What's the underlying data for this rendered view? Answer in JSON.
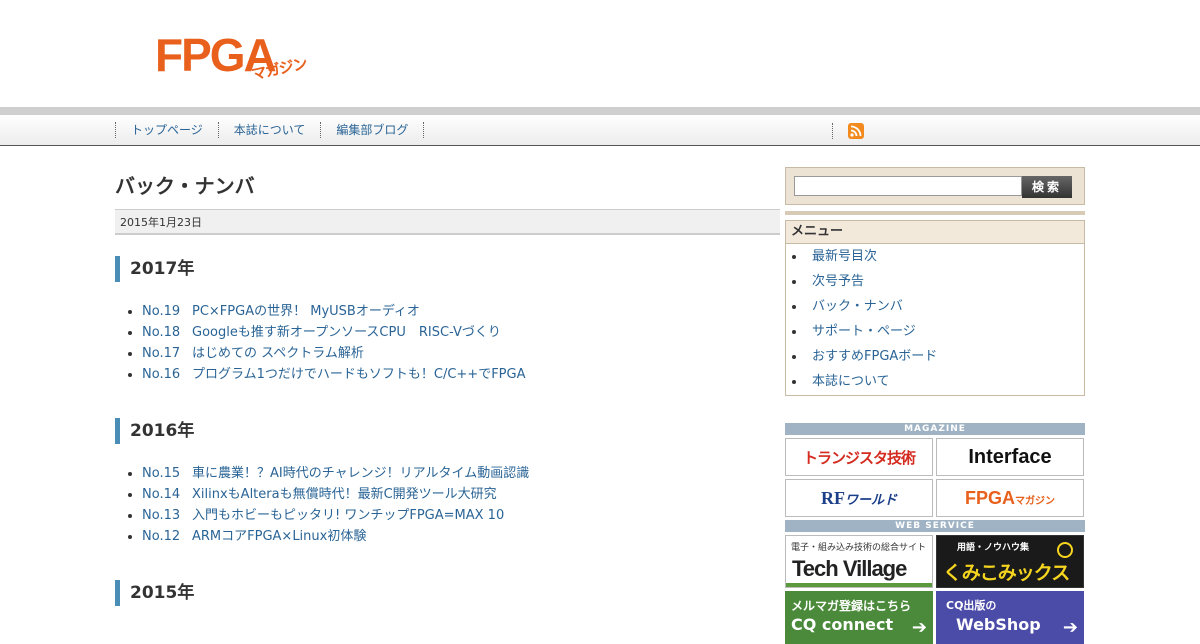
{
  "header": {
    "logo_main": "FPGA",
    "logo_sub": "マガジン"
  },
  "nav": {
    "items": [
      "トップページ",
      "本誌について",
      "編集部ブログ"
    ],
    "rss_icon": "rss-icon"
  },
  "main": {
    "title": "バック・ナンバ",
    "date": "2015年1月23日",
    "sections": [
      {
        "year": "2017年",
        "issues": [
          {
            "num": "No.19",
            "title": "PC×FPGAの世界！ MyUSBオーディオ"
          },
          {
            "num": "No.18",
            "title": "Googleも推す新オープンソースCPU　RISC-Vづくり"
          },
          {
            "num": "No.17",
            "title": "はじめての スペクトラム解析"
          },
          {
            "num": "No.16",
            "title": "プログラム1つだけでハードもソフトも！C/C++でFPGA"
          }
        ]
      },
      {
        "year": "2016年",
        "issues": [
          {
            "num": "No.15",
            "title": "車に農業！？AI時代のチャレンジ！リアルタイム動画認識"
          },
          {
            "num": "No.14",
            "title": "XilinxもAlteraも無償時代！最新C開発ツール大研究"
          },
          {
            "num": "No.13",
            "title": "入門もホビーもピッタリ! ワンチップFPGA=MAX 10"
          },
          {
            "num": "No.12",
            "title": "ARMコアFPGA×Linux初体験"
          }
        ]
      },
      {
        "year": "2015年",
        "issues": []
      }
    ]
  },
  "sidebar": {
    "search_button": "検索",
    "search_value": "",
    "menu_title": "メニュー",
    "menu_items": [
      "最新号目次",
      "次号予告",
      "バック・ナンバ",
      "サポート・ページ",
      "おすすめFPGAボード",
      "本誌について"
    ],
    "magazine_label": "MAGAZINE",
    "magazines": {
      "transistor": "トランジスタ技術",
      "interface": "Interface",
      "rf_main": "RF",
      "rf_sub": "ワールド",
      "fpga_main": "FPGA",
      "fpga_sub": "マガジン"
    },
    "webservice_label": "WEB SERVICE",
    "services": {
      "techvillage_sub": "電子・組み込み技術の総合サイト",
      "techvillage": "Tech Village",
      "kumikomi_sub": "用語・ノウハウ集",
      "kumikomi": "くみこみックス",
      "mailmag_sub": "メルマガ登録はこちら",
      "mailmag": "CQ connect",
      "webshop_sub": "CQ出版の",
      "webshop": "WebShop"
    }
  }
}
